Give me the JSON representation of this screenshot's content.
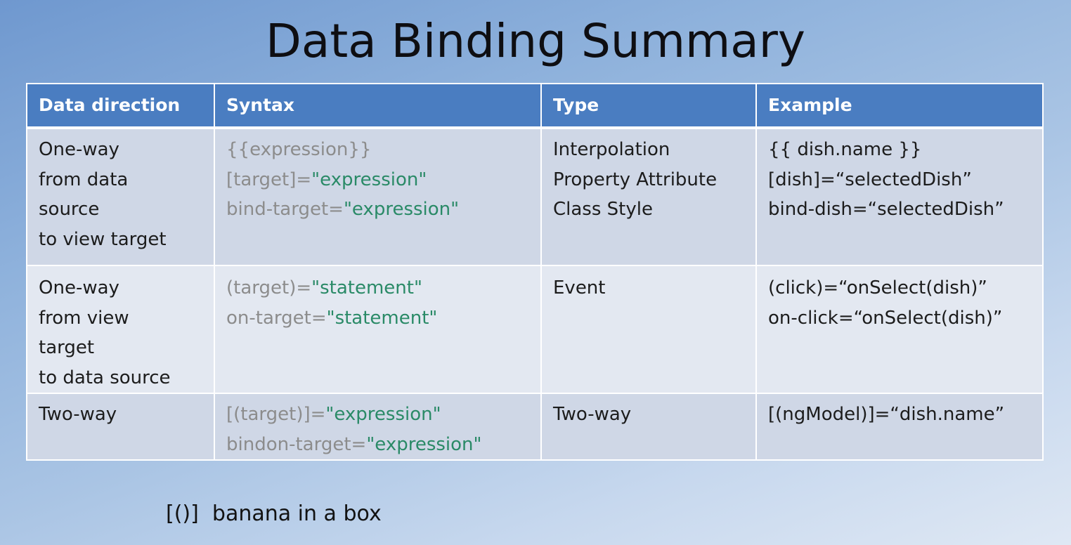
{
  "title": "Data Binding Summary",
  "table": {
    "headers": [
      "Data direction",
      "Syntax",
      "Type",
      "Example"
    ],
    "rows": [
      {
        "direction": [
          "One-way",
          "from data",
          "source",
          "to view target"
        ],
        "syntax": [
          {
            "prefix": "{{expression}}",
            "value": ""
          },
          {
            "prefix": "[target]=",
            "value": "\"expression\""
          },
          {
            "prefix": "bind-target=",
            "value": "\"expression\""
          }
        ],
        "type": [
          "Interpolation",
          "Property Attribute",
          "Class Style"
        ],
        "example": [
          "{{ dish.name }}",
          "[dish]=“selectedDish”",
          "bind-dish=“selectedDish”"
        ]
      },
      {
        "direction": [
          "One-way",
          "from view",
          "target",
          "to data source"
        ],
        "syntax": [
          {
            "prefix": "(target)=",
            "value": "\"statement\""
          },
          {
            "prefix": "on-target=",
            "value": "\"statement\""
          }
        ],
        "type": [
          "Event"
        ],
        "example": [
          "(click)=“onSelect(dish)”",
          "on-click=“onSelect(dish)”"
        ]
      },
      {
        "direction": [
          "Two-way"
        ],
        "syntax": [
          {
            "prefix": "[(target)]=",
            "value": "\"expression\""
          },
          {
            "prefix": "bindon-target=",
            "value": "\"expression\""
          }
        ],
        "type": [
          "Two-way"
        ],
        "example": [
          "[(ngModel)]=“dish.name”"
        ]
      }
    ]
  },
  "footer": {
    "symbol": "[()]",
    "text": "banana in a box"
  }
}
